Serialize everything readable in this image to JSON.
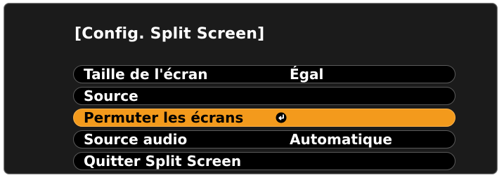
{
  "menu": {
    "title": "[Config. Split Screen]",
    "items": [
      {
        "label": "Taille de l'écran",
        "value": "Égal"
      },
      {
        "label": "Source",
        "value": ""
      },
      {
        "label": "Permuter les écrans",
        "value": "",
        "icon": "enter-icon",
        "selected": true
      },
      {
        "label": "Source audio",
        "value": "Automatique"
      },
      {
        "label": "Quitter Split Screen",
        "value": ""
      }
    ]
  },
  "colors": {
    "highlight": "#f39a1c",
    "background": "#1b1b1b",
    "text": "#ffffff"
  }
}
